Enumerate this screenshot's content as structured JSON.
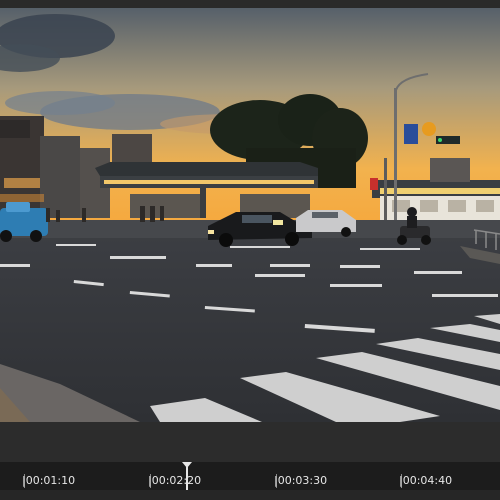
{
  "timeline": {
    "timecodes": [
      "|00:01:10",
      "|00:02:20",
      "|00:03:30",
      "|00:04:40"
    ]
  },
  "colors": {
    "app_background": "#1b1b1b",
    "panel_background": "#2c2c2c",
    "playhead": "#e8e8e8"
  }
}
